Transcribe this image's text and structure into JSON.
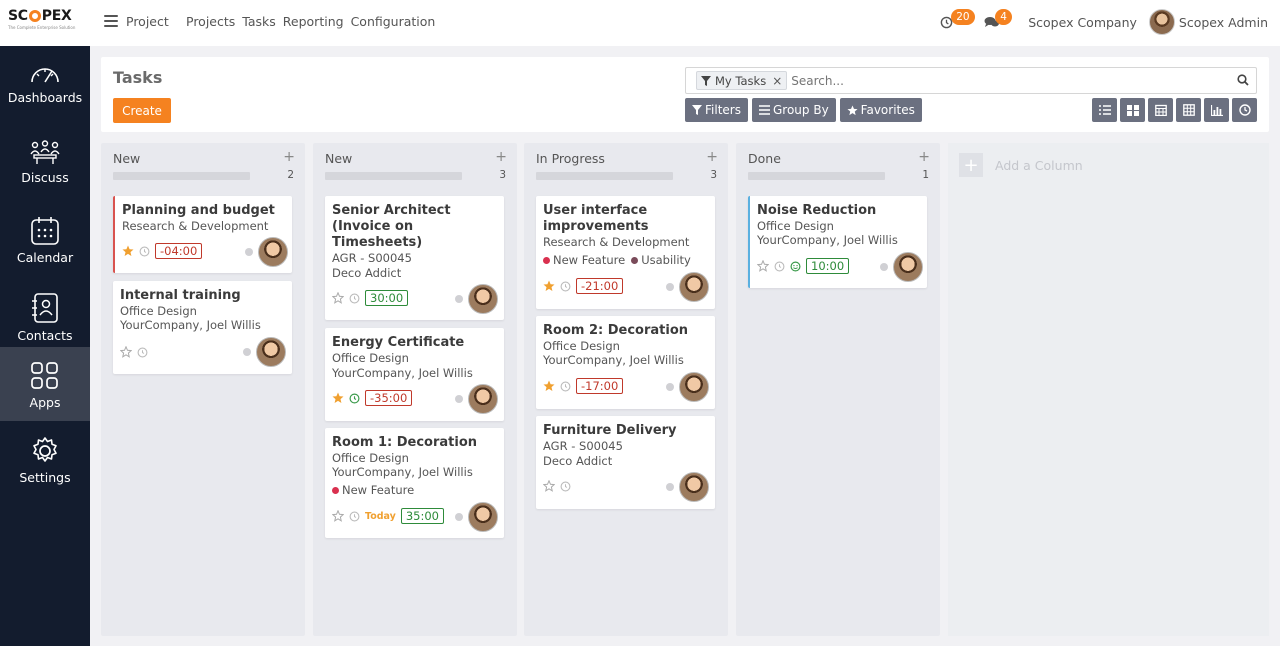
{
  "brand": {
    "logo": "SCOPEX",
    "tagline": "The Complete Enterprise Solution"
  },
  "topbar": {
    "app_name": "Project",
    "nav": [
      "Projects",
      "Tasks",
      "Reporting",
      "Configuration"
    ],
    "activity_count": "20",
    "message_count": "4",
    "company": "Scopex Company",
    "user": "Scopex Admin"
  },
  "sidebar": {
    "items": [
      {
        "label": "Dashboards",
        "icon": "speedometer-icon"
      },
      {
        "label": "Discuss",
        "icon": "people-icon"
      },
      {
        "label": "Calendar",
        "icon": "calendar-icon"
      },
      {
        "label": "Contacts",
        "icon": "contacts-book-icon"
      },
      {
        "label": "Apps",
        "icon": "apps-grid-icon"
      },
      {
        "label": "Settings",
        "icon": "gear-icon"
      }
    ],
    "active": "Apps"
  },
  "control": {
    "title": "Tasks",
    "create_label": "Create",
    "facet_label": "My Tasks",
    "search_placeholder": "Search...",
    "filters_label": "Filters",
    "groupby_label": "Group By",
    "favorites_label": "Favorites"
  },
  "columns": [
    {
      "title": "New",
      "count": "2"
    },
    {
      "title": "New",
      "count": "3"
    },
    {
      "title": "In Progress",
      "count": "3"
    },
    {
      "title": "Done",
      "count": "1"
    }
  ],
  "add_column_label": "Add a Column",
  "cards": {
    "c1": {
      "title": "Planning and budget",
      "line1": "Research & Development",
      "time": "-04:00"
    },
    "c2": {
      "title": "Internal training",
      "line1": "Office Design",
      "line2": "YourCompany, Joel Willis"
    },
    "c3": {
      "title": "Senior Architect (Invoice on Timesheets)",
      "line1": "AGR - S00045",
      "line2": "Deco Addict",
      "time": "30:00"
    },
    "c4": {
      "title": "Energy Certificate",
      "line1": "Office Design",
      "line2": "YourCompany, Joel Willis",
      "time": "-35:00"
    },
    "c5": {
      "title": "Room 1: Decoration",
      "line1": "Office Design",
      "line2": "YourCompany, Joel Willis",
      "tag1": "New Feature",
      "today": "Today",
      "time": "35:00"
    },
    "c6": {
      "title": "User interface improvements",
      "line1": "Research & Development",
      "tag1": "New Feature",
      "tag2": "Usability",
      "time": "-21:00"
    },
    "c7": {
      "title": "Room 2: Decoration",
      "line1": "Office Design",
      "line2": "YourCompany, Joel Willis",
      "time": "-17:00"
    },
    "c8": {
      "title": "Furniture Delivery",
      "line1": "AGR - S00045",
      "line2": "Deco Addict"
    },
    "c9": {
      "title": "Noise Reduction",
      "line1": "Office Design",
      "line2": "YourCompany, Joel Willis",
      "time": "10:00"
    }
  },
  "colors": {
    "accent": "#f58220",
    "sidebar": "#131c2e",
    "tag_new_feature": "#d9304f",
    "tag_usability": "#7a4b5a"
  }
}
